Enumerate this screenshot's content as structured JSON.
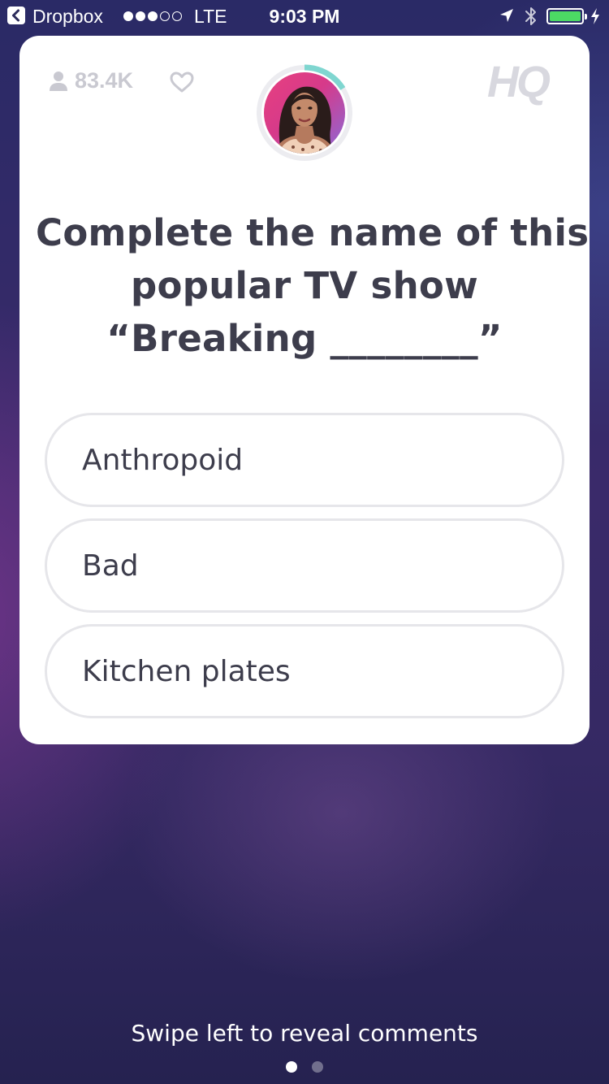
{
  "status_bar": {
    "back_app": "Dropbox",
    "carrier": "LTE",
    "time": "9:03 PM",
    "signal_bars_filled": 3,
    "signal_bars_total": 5,
    "battery_level": 1.0,
    "battery_color": "#4cd964"
  },
  "game": {
    "viewer_count": "83.4K",
    "logo": "HQ",
    "timer_progress": 0.16,
    "timer_color": "#7fd6d0"
  },
  "question": {
    "lines": [
      "Complete the name of this",
      "popular TV show",
      "“Breaking ________”"
    ]
  },
  "answers": [
    {
      "label": "Anthropoid"
    },
    {
      "label": "Bad"
    },
    {
      "label": "Kitchen plates"
    }
  ],
  "footer": {
    "hint": "Swipe left to reveal comments",
    "page_count": 2,
    "active_page": 1
  }
}
